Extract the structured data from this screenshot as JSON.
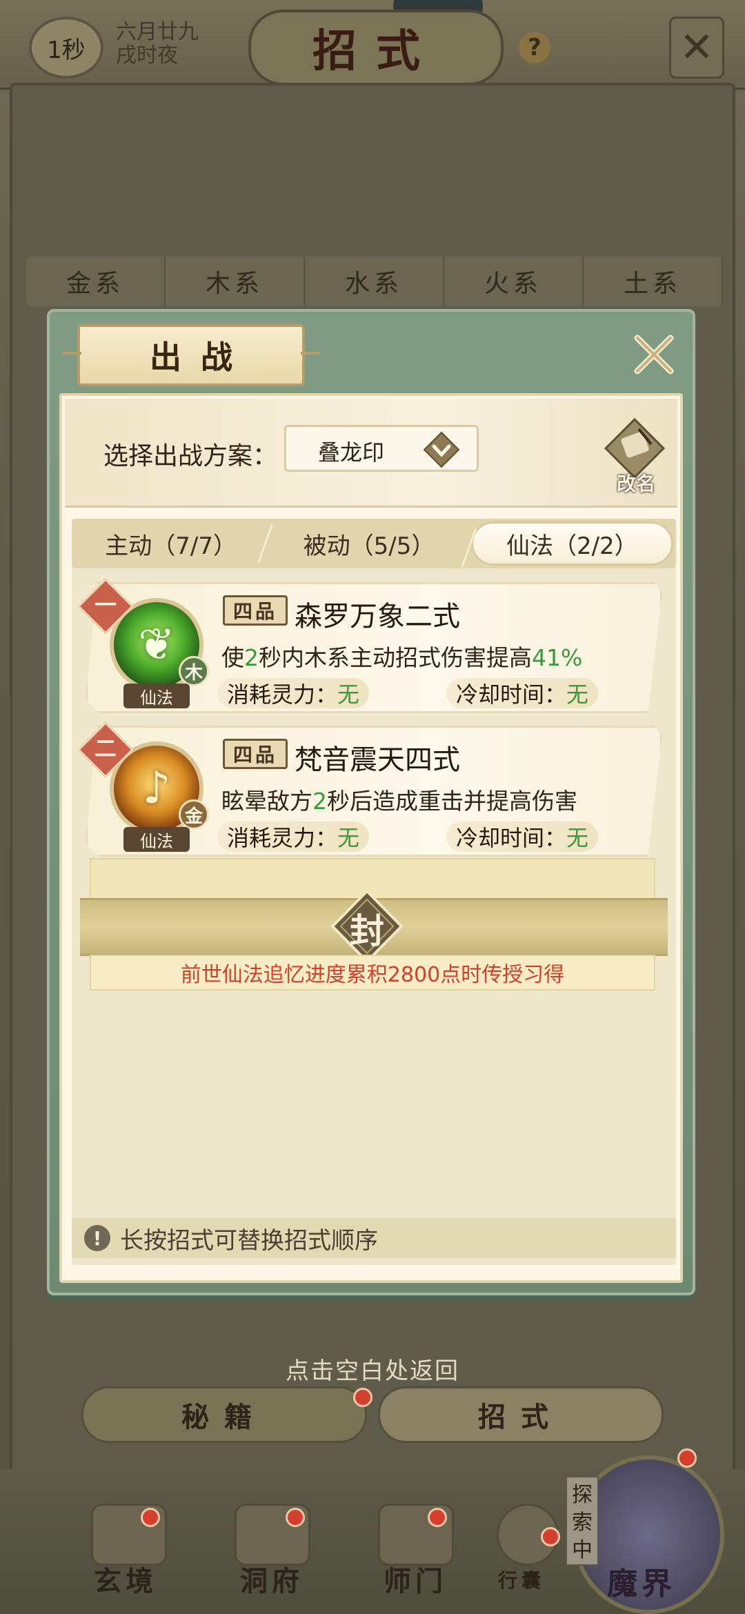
{
  "background": {
    "timer": "1秒",
    "date_line1": "六月廿九",
    "date_line2": "戌时夜",
    "page_title": "招式",
    "help": "?",
    "element_tabs": [
      "金系",
      "木系",
      "水系",
      "火系",
      "土系"
    ],
    "hint": "点击空白处返回",
    "sub_tabs": [
      "秘籍",
      "招式"
    ],
    "nav": [
      "玄境",
      "洞府",
      "师门",
      "行囊"
    ],
    "explore_tag": "探索中",
    "explore_label": "魔界"
  },
  "popup": {
    "title": "出战",
    "plan_label": "选择出战方案：",
    "plan_value": "叠龙印",
    "rename_label": "改名",
    "tabs": [
      {
        "label": "主动（7/7）"
      },
      {
        "label": "被动（5/5）"
      },
      {
        "label": "仙法（2/2）",
        "active": true
      }
    ],
    "skills": [
      {
        "rank": "一",
        "grade": "四品",
        "name": "森罗万象二式",
        "desc_pre": "使",
        "desc_num1": "2",
        "desc_mid": "秒内木系主动招式伤害提高",
        "desc_num2": "41%",
        "element": "木",
        "type": "仙法",
        "cost_label": "消耗灵力：",
        "cost_value": "无",
        "cd_label": "冷却时间：",
        "cd_value": "无"
      },
      {
        "rank": "二",
        "grade": "四品",
        "name": "梵音震天四式",
        "desc_pre": "眩晕敌方",
        "desc_num1": "2",
        "desc_mid": "秒后造成重击并提高伤害",
        "desc_num2": "",
        "element": "金",
        "type": "仙法",
        "cost_label": "消耗灵力：",
        "cost_value": "无",
        "cd_label": "冷却时间：",
        "cd_value": "无"
      }
    ],
    "sealed": {
      "char": "封",
      "text": "前世仙法追忆进度累积2800点时传授习得"
    },
    "tip": "长按招式可替换招式顺序"
  },
  "colors": {
    "highlight": "#3a9a3a",
    "warning": "#d0402a",
    "panel": "#fbf6e6",
    "frame": "#809b84"
  }
}
